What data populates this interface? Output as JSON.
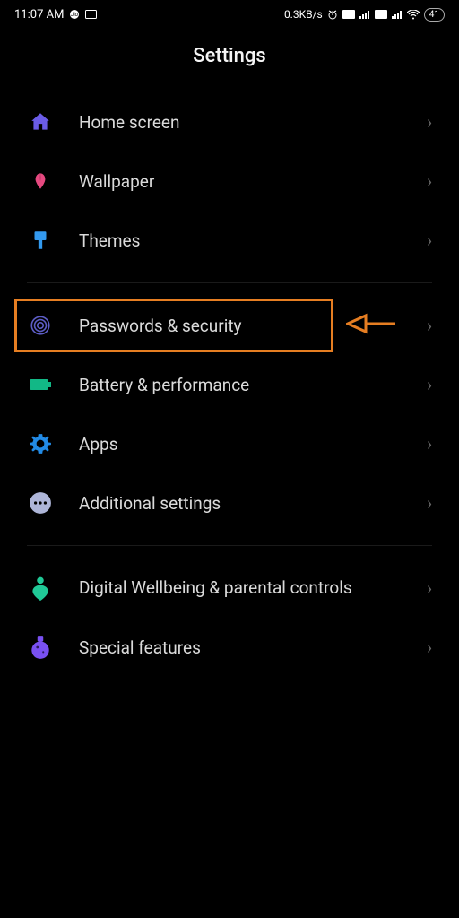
{
  "status_bar": {
    "time": "11:07 AM",
    "data_speed": "0.3KB/s",
    "battery": "41"
  },
  "page_title": "Settings",
  "items": [
    {
      "label": "Home screen",
      "icon_color": "#6b5ce7"
    },
    {
      "label": "Wallpaper",
      "icon_color": "#e64980"
    },
    {
      "label": "Themes",
      "icon_color": "#339af0"
    },
    {
      "label": "Passwords & security",
      "icon_color": "#5c5cc4"
    },
    {
      "label": "Battery & performance",
      "icon_color": "#12b886"
    },
    {
      "label": "Apps",
      "icon_color": "#228be6"
    },
    {
      "label": "Additional settings",
      "icon_color": "#adb5d8"
    },
    {
      "label": "Digital Wellbeing & parental controls",
      "icon_color": "#20c997"
    },
    {
      "label": "Special features",
      "icon_color": "#7950f2"
    }
  ],
  "annotation": {
    "highlight_color": "#e67e22"
  }
}
